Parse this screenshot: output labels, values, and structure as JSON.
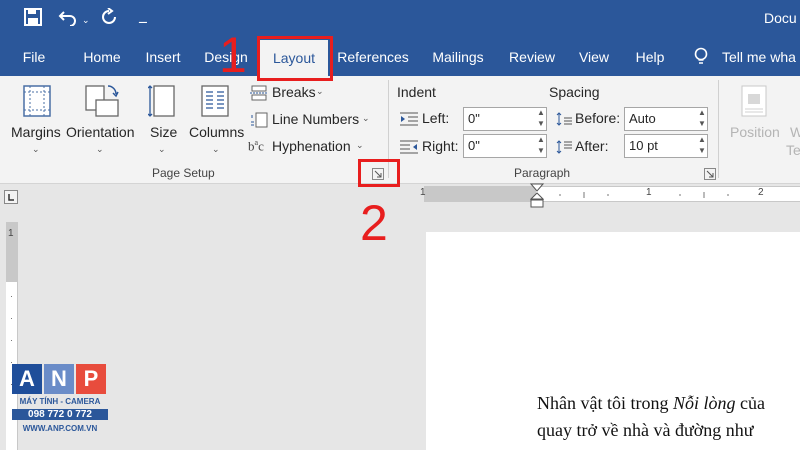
{
  "title_bar": {
    "doc_title": "Docu",
    "qat_icons": [
      "save-icon",
      "undo-icon",
      "redo-icon",
      "customize-icon"
    ]
  },
  "tabs": [
    "File",
    "Home",
    "Insert",
    "Design",
    "Layout",
    "References",
    "Mailings",
    "Review",
    "View",
    "Help"
  ],
  "active_tab": "Layout",
  "tell_me": "Tell me wha",
  "page_setup": {
    "margins": "Margins",
    "orientation": "Orientation",
    "size": "Size",
    "columns": "Columns",
    "breaks": "Breaks",
    "line_numbers": "Line Numbers",
    "hyphenation": "Hyphenation",
    "group_label": "Page Setup"
  },
  "paragraph": {
    "indent_label": "Indent",
    "spacing_label": "Spacing",
    "left_label": "Left:",
    "left_value": "0\"",
    "right_label": "Right:",
    "right_value": "0\"",
    "before_label": "Before:",
    "before_value": "Auto",
    "after_label": "After:",
    "after_value": "10 pt",
    "group_label": "Paragraph"
  },
  "arrange": {
    "position": "Position",
    "w": "W",
    "te": "Te"
  },
  "annotations": [
    "1",
    "2"
  ],
  "ruler_labels": [
    "1",
    "1",
    "2"
  ],
  "document": {
    "line1_a": "Nhân vật tôi trong ",
    "line1_b": "Nỗi lòng",
    "line1_c": " của",
    "line2": "quay trở về nhà và đường như"
  },
  "logo": {
    "letters": [
      "A",
      "N",
      "P"
    ],
    "sub1": "MÁY TÍNH - CAMERA",
    "phone": "098 772 0 772",
    "url": "WWW.ANP.COM.VN"
  },
  "colors": {
    "brand": "#2b579a",
    "annotation": "#e81e1e"
  }
}
